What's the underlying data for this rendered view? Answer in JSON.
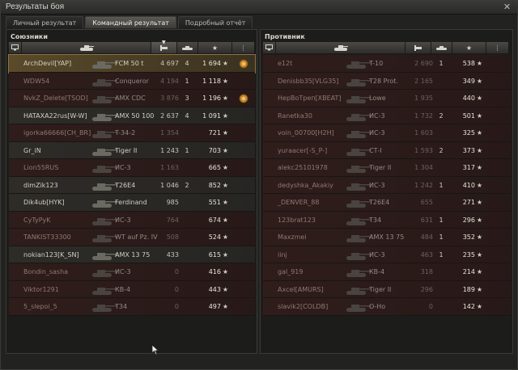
{
  "window": {
    "title": "Результаты боя",
    "close_icon": "close-icon"
  },
  "tabs": [
    {
      "label": "Личный результат",
      "active": false
    },
    {
      "label": "Командный результат",
      "active": true
    },
    {
      "label": "Подробный отчёт",
      "active": false
    }
  ],
  "colors": {
    "accent": "#8b7640",
    "dead_row": "#2f1d1b",
    "alive_row": "#2e2c27"
  },
  "allies": {
    "title": "Союзники",
    "columns": [
      "squad-icon",
      "tank-type-icon",
      "damage-sort-icon",
      "kills-icon",
      "xp-icon",
      "achievements-icon"
    ],
    "rows": [
      {
        "name": "ArchDevil[YAP]",
        "tank": "FCM 50 t",
        "damage": "4 697",
        "kills": "4",
        "xp": "1 694",
        "medal": true,
        "dead": false,
        "player": true
      },
      {
        "name": "WDW54",
        "tank": "Conqueror",
        "damage": "4 194",
        "kills": "1",
        "xp": "1 118",
        "medal": false,
        "dead": true,
        "player": false
      },
      {
        "name": "NvkZ_Delete[TSOD]",
        "tank": "AMX CDC",
        "damage": "3 876",
        "kills": "3",
        "xp": "1 196",
        "medal": true,
        "dead": true,
        "player": false
      },
      {
        "name": "HATAXA22rus[W-W]",
        "tank": "AMX 50 100",
        "damage": "2 637",
        "kills": "4",
        "xp": "1 091",
        "medal": false,
        "dead": false,
        "player": false
      },
      {
        "name": "igorka66666[CH_BR]",
        "tank": "T-34-2",
        "damage": "1 354",
        "kills": "",
        "xp": "721",
        "medal": false,
        "dead": true,
        "player": false
      },
      {
        "name": "Gr_iN",
        "tank": "Tiger II",
        "damage": "1 243",
        "kills": "1",
        "xp": "703",
        "medal": false,
        "dead": false,
        "player": false
      },
      {
        "name": "Lion55RUS",
        "tank": "ИС-3",
        "damage": "1 163",
        "kills": "",
        "xp": "665",
        "medal": false,
        "dead": true,
        "player": false
      },
      {
        "name": "dimZik123",
        "tank": "T26E4",
        "damage": "1 046",
        "kills": "2",
        "xp": "852",
        "medal": false,
        "dead": false,
        "player": false
      },
      {
        "name": "Dik4ub[HYK]",
        "tank": "Ferdinand",
        "damage": "985",
        "kills": "",
        "xp": "551",
        "medal": false,
        "dead": false,
        "player": false
      },
      {
        "name": "CyTyPyK",
        "tank": "ИС-3",
        "damage": "764",
        "kills": "",
        "xp": "674",
        "medal": false,
        "dead": true,
        "player": false
      },
      {
        "name": "TANKIST33300",
        "tank": "WT auf Pz. IV",
        "damage": "508",
        "kills": "",
        "xp": "524",
        "medal": false,
        "dead": true,
        "player": false
      },
      {
        "name": "nokian123[K_SN]",
        "tank": "AMX 13 75",
        "damage": "433",
        "kills": "",
        "xp": "615",
        "medal": false,
        "dead": false,
        "player": false
      },
      {
        "name": "Bondin_sasha",
        "tank": "ИС-3",
        "damage": "0",
        "kills": "",
        "xp": "416",
        "medal": false,
        "dead": true,
        "player": false
      },
      {
        "name": "Viktor1291",
        "tank": "КВ-4",
        "damage": "0",
        "kills": "",
        "xp": "443",
        "medal": false,
        "dead": true,
        "player": false
      },
      {
        "name": "5_slepoi_5",
        "tank": "T34",
        "damage": "0",
        "kills": "",
        "xp": "497",
        "medal": false,
        "dead": true,
        "player": false
      }
    ]
  },
  "enemies": {
    "title": "Противник",
    "rows": [
      {
        "name": "e12t",
        "tank": "T-10",
        "damage": "2 690",
        "kills": "1",
        "xp": "538",
        "dead": true
      },
      {
        "name": "Denisbb35[VLG35]",
        "tank": "T28 Prot.",
        "damage": "2 165",
        "kills": "",
        "xp": "349",
        "dead": true
      },
      {
        "name": "HepBoTpeп[XBEAT]",
        "tank": "Lowe",
        "damage": "1 935",
        "kills": "",
        "xp": "440",
        "dead": true
      },
      {
        "name": "Ranetka30",
        "tank": "ИС-3",
        "damage": "1 732",
        "kills": "2",
        "xp": "501",
        "dead": true
      },
      {
        "name": "voin_00700[H2H]",
        "tank": "ИС-3",
        "damage": "1 603",
        "kills": "",
        "xp": "325",
        "dead": true
      },
      {
        "name": "yuraacer[-S_P-]",
        "tank": "СТ-I",
        "damage": "1 593",
        "kills": "2",
        "xp": "373",
        "dead": true
      },
      {
        "name": "alekc25101978",
        "tank": "Tiger II",
        "damage": "1 304",
        "kills": "",
        "xp": "317",
        "dead": true
      },
      {
        "name": "dedyshka_Akakiy",
        "tank": "ИС-3",
        "damage": "1 242",
        "kills": "1",
        "xp": "410",
        "dead": true
      },
      {
        "name": "_DENVER_88",
        "tank": "T26E4",
        "damage": "655",
        "kills": "",
        "xp": "271",
        "dead": true
      },
      {
        "name": "123brat123",
        "tank": "T34",
        "damage": "631",
        "kills": "1",
        "xp": "296",
        "dead": true
      },
      {
        "name": "Maxzmei",
        "tank": "AMX 13 75",
        "damage": "484",
        "kills": "1",
        "xp": "352",
        "dead": true
      },
      {
        "name": "iinj",
        "tank": "ИС-3",
        "damage": "463",
        "kills": "1",
        "xp": "235",
        "dead": true
      },
      {
        "name": "gal_919",
        "tank": "КВ-4",
        "damage": "318",
        "kills": "",
        "xp": "214",
        "dead": true
      },
      {
        "name": "Axcel[AMURS]",
        "tank": "Tiger II",
        "damage": "296",
        "kills": "",
        "xp": "189",
        "dead": true
      },
      {
        "name": "slavik2[COLDB]",
        "tank": "О-Но",
        "damage": "0",
        "kills": "",
        "xp": "142",
        "dead": true
      }
    ]
  }
}
